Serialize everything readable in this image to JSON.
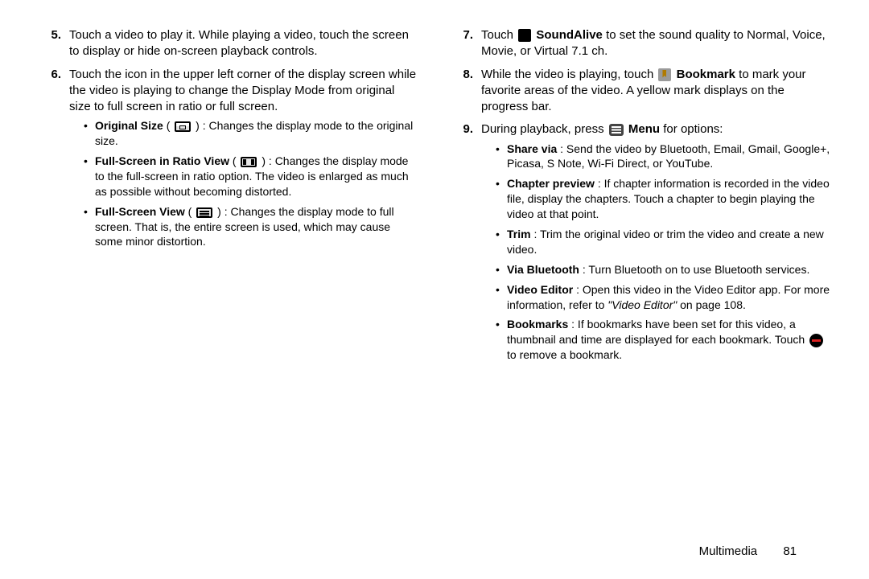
{
  "left": {
    "items": [
      {
        "num": "5.",
        "text": "Touch a video to play it. While playing a video, touch the screen to display or hide on-screen playback controls."
      },
      {
        "num": "6.",
        "text": "Touch the icon in the upper left corner of the display screen while the video is playing to change the Display Mode from original size to full screen in ratio or full screen.",
        "bullets": [
          {
            "bold": "Original Size",
            "icon": "original-size-icon",
            "after": ": Changes the display mode to the original size."
          },
          {
            "bold": "Full-Screen in Ratio View",
            "icon": "ratio-view-icon",
            "after": ": Changes the display mode to the full-screen in ratio option. The video is enlarged as much as possible without becoming distorted."
          },
          {
            "bold": "Full-Screen View",
            "icon": "full-screen-icon",
            "after": ": Changes the display mode to full screen. That is, the entire screen is used, which may cause some minor distortion."
          }
        ]
      }
    ]
  },
  "right": {
    "items": [
      {
        "num": "7.",
        "pre": "Touch ",
        "bold": "SoundAlive",
        "after": " to set the sound quality to Normal, Voice, Movie, or Virtual 7.1 ch."
      },
      {
        "num": "8.",
        "pre": "While the video is playing, touch ",
        "bold": "Bookmark",
        "after": " to mark your favorite areas of the video. A yellow mark displays on the progress bar."
      },
      {
        "num": "9.",
        "pre": "During playback, press ",
        "bold": "Menu",
        "after": " for options:",
        "bullets": [
          {
            "bold": "Share via",
            "after": ": Send the video by Bluetooth, Email, Gmail, Google+, Picasa, S Note, Wi-Fi Direct, or YouTube."
          },
          {
            "bold": "Chapter preview",
            "after": ": If chapter information is recorded in the video file, display the chapters. Touch a chapter to begin playing the video at that point."
          },
          {
            "bold": "Trim",
            "after": ": Trim the original video or trim the video and create a new video."
          },
          {
            "bold": "Via Bluetooth",
            "after": ": Turn Bluetooth on to use Bluetooth services."
          },
          {
            "bold": "Video Editor",
            "after": ": Open this video in the Video Editor app. For more information, refer to ",
            "italic": "\"Video Editor\"",
            "tail": "  on page 108."
          },
          {
            "bold": "Bookmarks",
            "after": ": If bookmarks have been set for this video, a thumbnail and time are displayed for each bookmark. Touch ",
            "icon": "remove-bookmark-icon",
            "tail": " to remove a bookmark."
          }
        ]
      }
    ]
  },
  "footer": {
    "section": "Multimedia",
    "page": "81"
  }
}
